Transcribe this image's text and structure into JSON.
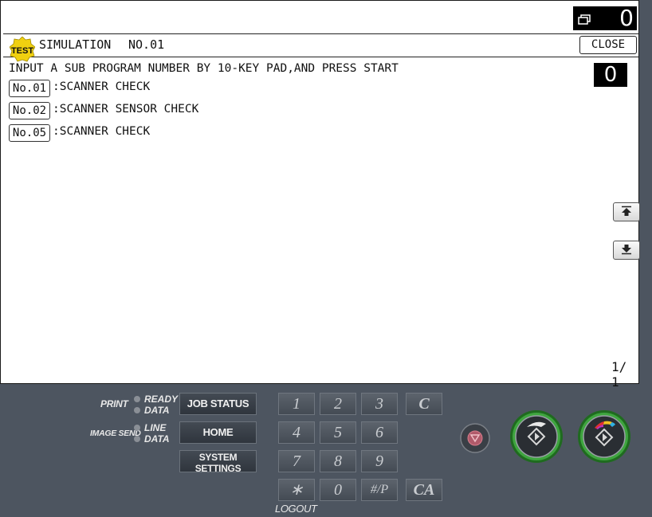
{
  "counter": {
    "icon": "copy-stack-icon",
    "value": "0"
  },
  "header": {
    "badge": "TEST",
    "title": "SIMULATION",
    "number": "NO.01",
    "close_label": "CLOSE"
  },
  "main": {
    "instruction": "INPUT A SUB PROGRAM NUMBER BY 10-KEY PAD,AND PRESS START",
    "input_value": "0",
    "programs": [
      {
        "button": "No.01",
        "desc": ":SCANNER CHECK"
      },
      {
        "button": "No.02",
        "desc": ":SCANNER SENSOR CHECK"
      },
      {
        "button": "No.05",
        "desc": ":SCANNER CHECK"
      }
    ],
    "scroll_up_icon": "scroll-up-arrow-icon",
    "scroll_down_icon": "scroll-down-arrow-icon",
    "page_indicator": "1/ 1"
  },
  "panel": {
    "print_label": "PRINT",
    "ready_label": "READY",
    "data_label": "DATA",
    "image_send_label": "IMAGE SEND",
    "line_label": "LINE",
    "data_label2": "DATA",
    "job_status": "JOB STATUS",
    "home": "HOME",
    "system_settings_line1": "SYSTEM",
    "system_settings_line2": "SETTINGS",
    "keys": [
      "1",
      "2",
      "3",
      "C",
      "4",
      "5",
      "6",
      "7",
      "8",
      "9",
      "∗",
      "0",
      "#/P",
      "CA"
    ],
    "logout": "LOGOUT"
  },
  "colors": {
    "panel_bg": "#4d5560",
    "start_ring": "#3a9a3a"
  }
}
